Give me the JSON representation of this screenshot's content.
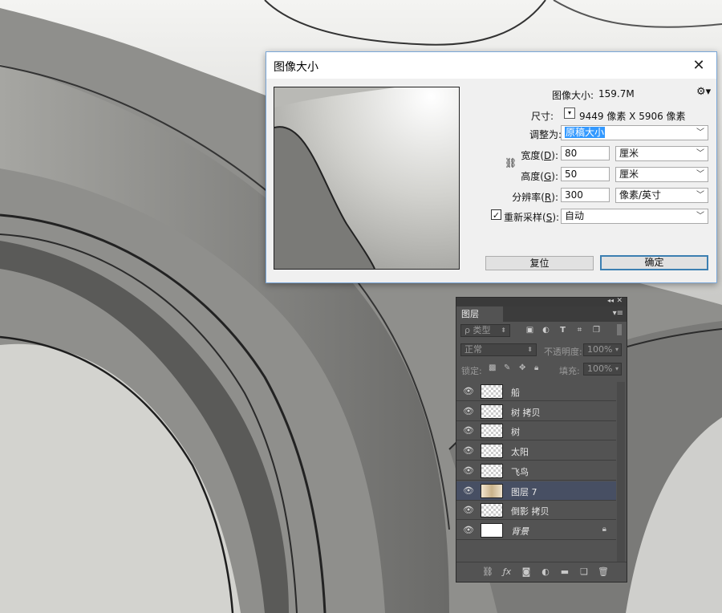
{
  "dialog": {
    "title": "图像大小",
    "close_glyph": "✕",
    "image_size_label": "图像大小:",
    "image_size_value": "159.7M",
    "settings_icon": "gear-icon",
    "dimensions_label": "尺寸:",
    "dimensions_value": "9449 像素  X  5906 像素",
    "fit_to_label": "调整为:",
    "fit_to_value": "原稿大小",
    "width_label_pre": "宽度(",
    "width_label_key": "D",
    "width_label_post": "):",
    "width_value": "80",
    "width_unit": "厘米",
    "height_label_pre": "高度(",
    "height_label_key": "G",
    "height_label_post": "):",
    "height_value": "50",
    "height_unit": "厘米",
    "resolution_label_pre": "分辨率(",
    "resolution_label_key": "R",
    "resolution_label_post": "):",
    "resolution_value": "300",
    "resolution_unit": "像素/英寸",
    "resample_checked": true,
    "resample_label_pre": "重新采样(",
    "resample_label_key": "S",
    "resample_label_post": "):",
    "resample_value": "自动",
    "reset_button": "复位",
    "ok_button": "确定",
    "accent_color": "#3c7fb1"
  },
  "layers_panel": {
    "tab_label": "图层",
    "filter_type": "ρ 类型",
    "blend_mode": "正常",
    "opacity_label": "不透明度:",
    "opacity_value": "100%",
    "lock_label": "锁定:",
    "fill_label": "填充:",
    "fill_value": "100%",
    "layers": [
      {
        "name": "船",
        "visible": true,
        "thumb": "transparent",
        "selected": false,
        "locked": false
      },
      {
        "name": "树 拷贝",
        "visible": true,
        "thumb": "transparent",
        "selected": false,
        "locked": false
      },
      {
        "name": "树",
        "visible": true,
        "thumb": "transparent",
        "selected": false,
        "locked": false
      },
      {
        "name": "太阳",
        "visible": true,
        "thumb": "transparent",
        "selected": false,
        "locked": false
      },
      {
        "name": "飞鸟",
        "visible": true,
        "thumb": "transparent",
        "selected": false,
        "locked": false
      },
      {
        "name": "图层 7",
        "visible": true,
        "thumb": "image",
        "selected": true,
        "locked": false
      },
      {
        "name": "倒影 拷贝",
        "visible": true,
        "thumb": "transparent",
        "selected": false,
        "locked": false
      },
      {
        "name": "背景",
        "visible": true,
        "thumb": "white",
        "selected": false,
        "locked": true
      }
    ],
    "selection_color": "#474f63"
  }
}
